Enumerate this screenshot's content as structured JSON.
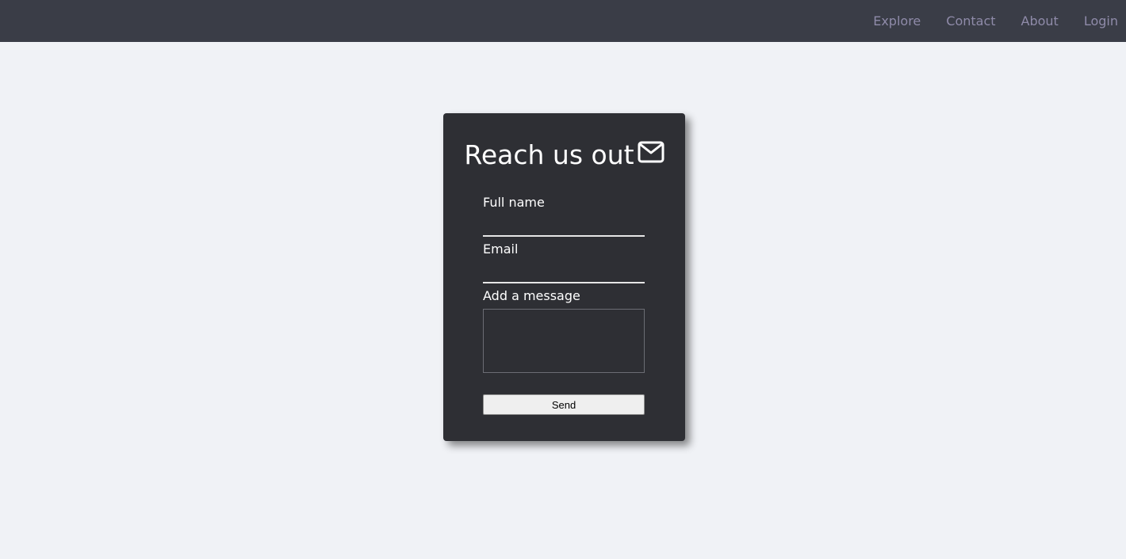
{
  "nav": {
    "links": [
      {
        "label": "Explore"
      },
      {
        "label": "Contact"
      },
      {
        "label": "About"
      },
      {
        "label": "Login"
      }
    ]
  },
  "form": {
    "title": "Reach us out",
    "title_icon": "envelope-icon",
    "full_name": {
      "label": "Full name",
      "value": ""
    },
    "email": {
      "label": "Email",
      "value": ""
    },
    "message": {
      "label": "Add a message",
      "value": ""
    },
    "send_label": "Send"
  },
  "colors": {
    "page_background": "#f0f2f6",
    "navbar_background": "#3a3d47",
    "nav_link": "#8f8ba9",
    "card_background": "#2e2f34",
    "text": "#ffffff",
    "button_background": "#efefef"
  }
}
